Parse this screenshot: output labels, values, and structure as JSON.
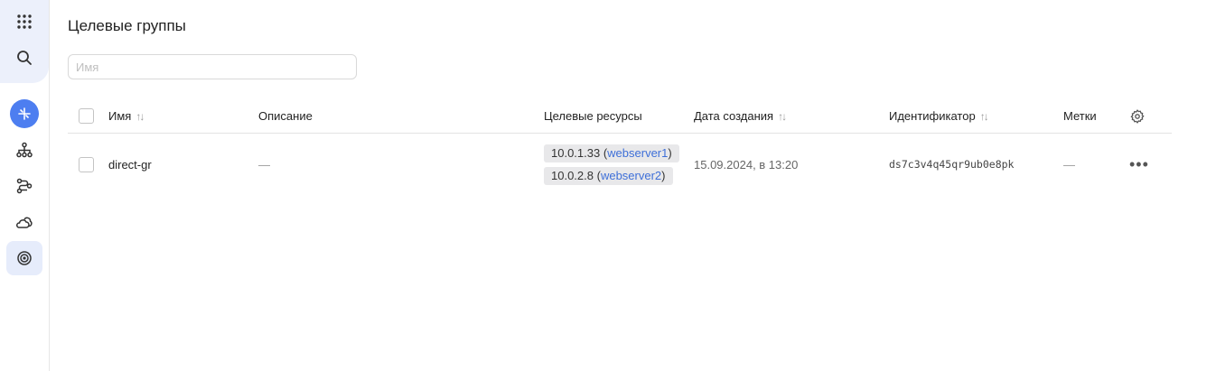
{
  "page": {
    "title": "Целевые группы",
    "search_placeholder": "Имя",
    "search_value": ""
  },
  "sidebar": {
    "items": [
      {
        "name": "apps-grid-icon",
        "active": false
      },
      {
        "name": "search-icon",
        "active": false
      },
      {
        "name": "network-load-balancer-icon",
        "active": false,
        "highlighted": true
      },
      {
        "name": "hierarchy-icon",
        "active": false
      },
      {
        "name": "routes-icon",
        "active": false
      },
      {
        "name": "clouds-icon",
        "active": false
      },
      {
        "name": "target-groups-icon",
        "active": true
      }
    ]
  },
  "table": {
    "columns": {
      "name": "Имя",
      "description": "Описание",
      "targets": "Целевые ресурсы",
      "created": "Дата создания",
      "id": "Идентификатор",
      "labels": "Метки"
    },
    "rows": [
      {
        "name": "direct-gr",
        "description": "—",
        "targets": [
          {
            "ip": "10.0.1.33",
            "open": " (",
            "host": "webserver1",
            "close": ")"
          },
          {
            "ip": "10.0.2.8",
            "open": " (",
            "host": "webserver2",
            "close": ")"
          }
        ],
        "created": "15.09.2024, в 13:20",
        "id": "ds7c3v4q45qr9ub0e8pk",
        "labels": "—"
      }
    ]
  },
  "colors": {
    "accent": "#4d7ef0",
    "link": "#3e6fd8",
    "tag_bg": "#e8e8ea",
    "sidebar_top_bg": "#ecf0fb"
  }
}
